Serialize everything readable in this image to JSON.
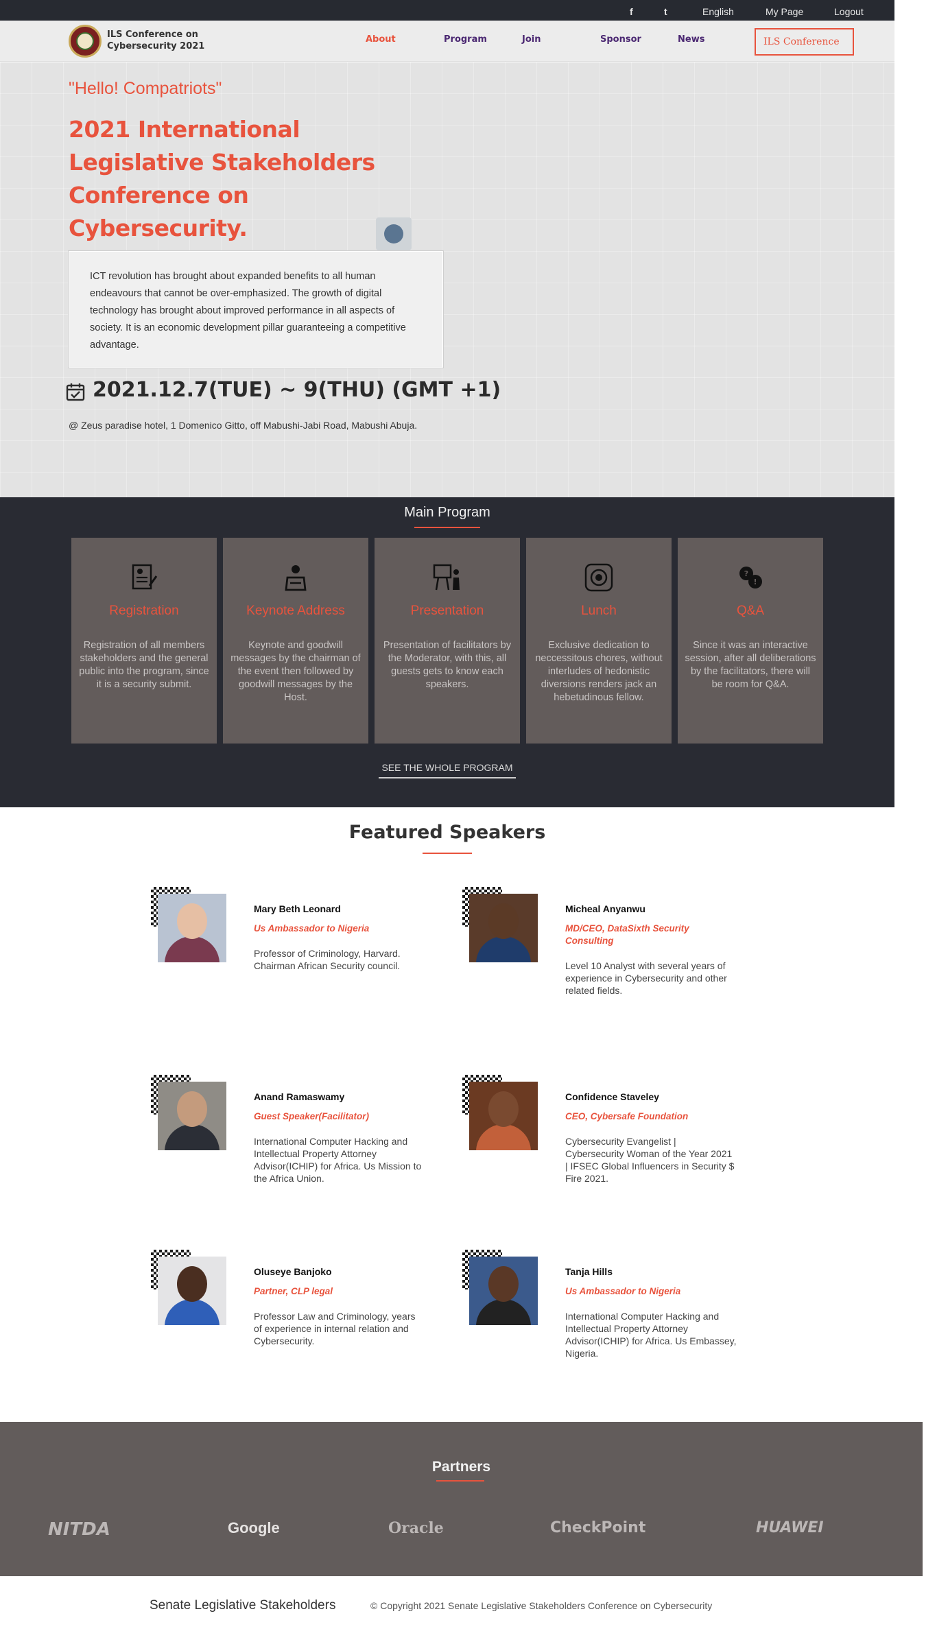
{
  "topbar": {
    "facebook_icon": "f",
    "twitter_icon": "t",
    "language": "English",
    "my_page": "My Page",
    "logout": "Logout"
  },
  "header": {
    "logo_line1": "ILS Conference on",
    "logo_line2": "Cybersecurity 2021",
    "nav": [
      "About",
      "Program",
      "Join",
      "Sponsor",
      "News"
    ],
    "cta": "ILS Conference"
  },
  "hero": {
    "greeting": "\"Hello! Compatriots\"",
    "title": "2021 International Legislative Stakeholders Conference on Cybersecurity.",
    "intro": "ICT revolution has brought about expanded benefits to all human endeavours that cannot be over-emphasized. The growth of digital technology has brought about improved performance in all aspects of society. It is an economic development pillar guaranteeing a competitive advantage.",
    "date": "2021.12.7(TUE) ~ 9(THU) (GMT +1)",
    "venue": "@ Zeus paradise hotel, 1 Domenico Gitto, off Mabushi-Jabi Road, Mabushi Abuja."
  },
  "program": {
    "title": "Main Program",
    "cards": [
      {
        "icon": "registration-form-icon",
        "title": "Registration",
        "desc": "Registration of all members stakeholders and the general public into the program, since it is a security submit."
      },
      {
        "icon": "speaker-podium-icon",
        "title": "Keynote Address",
        "desc": "Keynote and goodwill messages by the chairman of the event then followed by goodwill messages by the Host."
      },
      {
        "icon": "presentation-board-icon",
        "title": "Presentation",
        "desc": "Presentation of facilitators by the Moderator, with this, all guests gets to know each speakers."
      },
      {
        "icon": "dinner-plate-icon",
        "title": "Lunch",
        "desc": "Exclusive dedication to neccessitous chores, without interludes of hedonistic diversions renders jack an hebetudinous fellow."
      },
      {
        "icon": "chat-bubbles-icon",
        "title": "Q&A",
        "desc": "Since it was an interactive session, after all deliberations by the facilitators, there will be room for Q&A."
      }
    ],
    "see_all": "SEE THE WHOLE PROGRAM"
  },
  "speakers": {
    "title": "Featured Speakers",
    "items": [
      {
        "name": "Mary Beth Leonard",
        "role": "Us Ambassador to Nigeria",
        "bio": "Professor of Criminology, Harvard. Chairman African Security council."
      },
      {
        "name": "Micheal Anyanwu",
        "role": "MD/CEO, DataSixth Security Consulting",
        "bio": "Level 10 Analyst with several years of experience in Cybersecurity and other related fields."
      },
      {
        "name": "Anand Ramaswamy",
        "role": "Guest Speaker(Facilitator)",
        "bio": "International Computer Hacking and Intellectual Property Attorney Advisor(ICHIP) for Africa. Us Mission to the Africa Union."
      },
      {
        "name": "Confidence Staveley",
        "role": "CEO, Cybersafe Foundation",
        "bio": "Cybersecurity Evangelist | Cybersecurity Woman of the Year 2021 | IFSEC Global Influencers in Security $ Fire 2021."
      },
      {
        "name": "Oluseye Banjoko",
        "role": "Partner, CLP legal",
        "bio": "Professor Law and Criminology, years of experience in internal relation and Cybersecurity."
      },
      {
        "name": "Tanja Hills",
        "role": "Us Ambassador to Nigeria",
        "bio": "International Computer Hacking and Intellectual Property Attorney Advisor(ICHIP) for Africa. Us Embassey, Nigeria."
      }
    ]
  },
  "partners": {
    "title": "Partners",
    "logos": [
      "NITDA",
      "Google",
      "Oracle",
      "CheckPoint",
      "HUAWEI"
    ]
  },
  "footer": {
    "brand": "Senate Legislative Stakeholders",
    "copyright": "© Copyright 2021 Senate Legislative Stakeholders Conference on Cybersecurity"
  },
  "colors": {
    "accent": "#e8533d",
    "nav_purple": "#4b2872",
    "dark_band": "#292b33",
    "card_bg": "#635c5b"
  }
}
